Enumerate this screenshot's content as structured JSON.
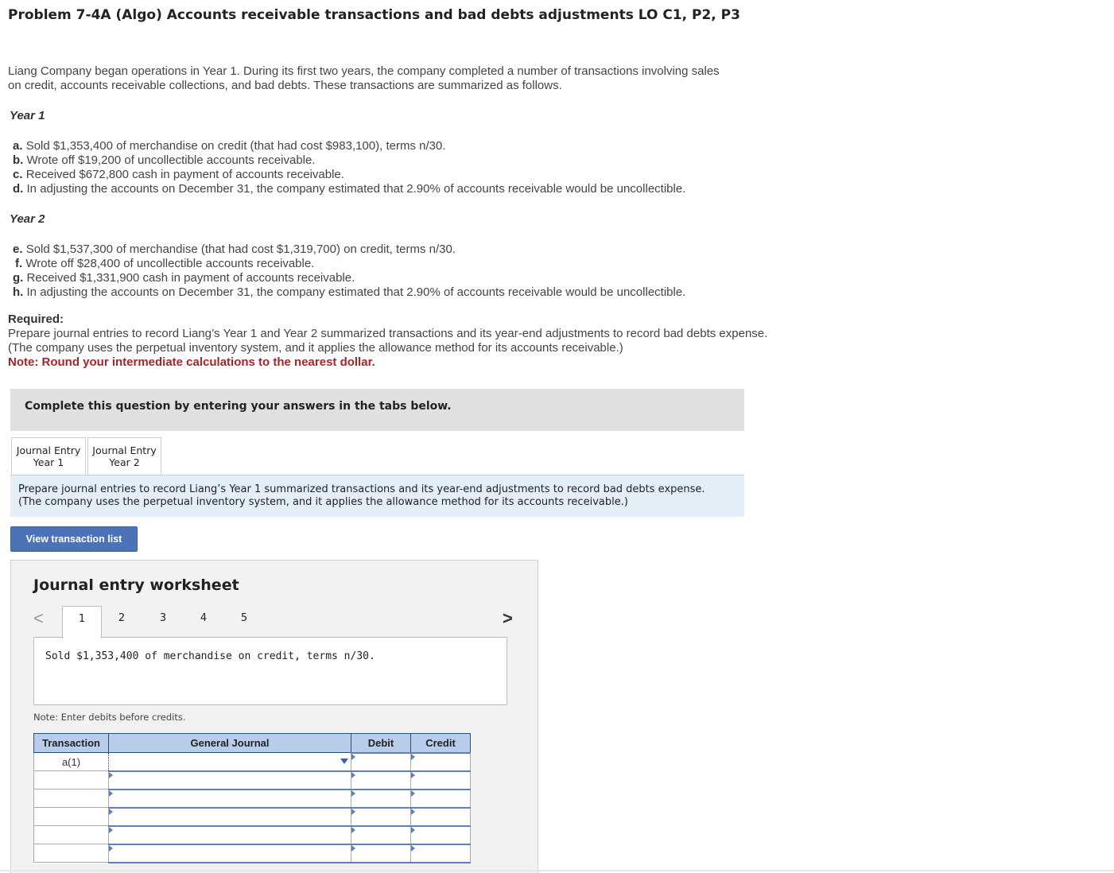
{
  "title": "Problem 7-4A (Algo) Accounts receivable transactions and bad debts adjustments LO C1, P2, P3",
  "intro_line1": "Liang Company began operations in Year 1. During its first two years, the company completed a number of transactions involving sales",
  "intro_line2": "on credit, accounts receivable collections, and bad debts. These transactions are summarized as follows.",
  "year1": {
    "heading": "Year 1",
    "items": [
      {
        "letter": "a.",
        "text": "Sold $1,353,400 of merchandise on credit (that had cost $983,100), terms n/30."
      },
      {
        "letter": "b.",
        "text": "Wrote off $19,200 of uncollectible accounts receivable."
      },
      {
        "letter": "c.",
        "text": "Received $672,800 cash in payment of accounts receivable."
      },
      {
        "letter": "d.",
        "text": "In adjusting the accounts on December 31, the company estimated that 2.90% of accounts receivable would be uncollectible."
      }
    ]
  },
  "year2": {
    "heading": "Year 2",
    "items": [
      {
        "letter": "e.",
        "text": "Sold $1,537,300 of merchandise (that had cost $1,319,700) on credit, terms n/30."
      },
      {
        "letter": "f.",
        "text": "Wrote off $28,400 of uncollectible accounts receivable."
      },
      {
        "letter": "g.",
        "text": "Received $1,331,900 cash in payment of accounts receivable."
      },
      {
        "letter": "h.",
        "text": "In adjusting the accounts on December 31, the company estimated that 2.90% of accounts receivable would be uncollectible."
      }
    ]
  },
  "required": {
    "heading": "Required:",
    "text": "Prepare journal entries to record Liang’s Year 1 and Year 2 summarized transactions and its year-end adjustments to record bad debts expense. (The company uses the perpetual inventory system, and it applies the allowance method for its accounts receivable.)",
    "note": "Note: Round your intermediate calculations to the nearest dollar."
  },
  "complete_banner": "Complete this question by entering your answers in the tabs below.",
  "tabs": [
    {
      "line1": "Journal Entry",
      "line2": "Year 1"
    },
    {
      "line1": "Journal Entry",
      "line2": "Year 2"
    }
  ],
  "instruction_line1": "Prepare journal entries to record Liang’s Year 1 summarized transactions and its year-end adjustments to record bad debts expense.",
  "instruction_line2": "(The company uses the perpetual inventory system, and it applies the allowance method for its accounts receivable.)",
  "view_button": "View transaction list",
  "worksheet": {
    "title": "Journal entry worksheet",
    "nav_prev": "<",
    "nav_next": ">",
    "pages": [
      "1",
      "2",
      "3",
      "4",
      "5"
    ],
    "active_page": "1",
    "description": "Sold $1,353,400 of merchandise on credit, terms n/30.",
    "note": "Note: Enter debits before credits.",
    "columns": [
      "Transaction",
      "General Journal",
      "Debit",
      "Credit"
    ],
    "first_transaction": "a(1)"
  },
  "colors": {
    "note_red": "#a6232a",
    "button_blue": "#4c72b7",
    "header_blue": "#b7cdea",
    "instruction_bg": "#e3eef9"
  }
}
